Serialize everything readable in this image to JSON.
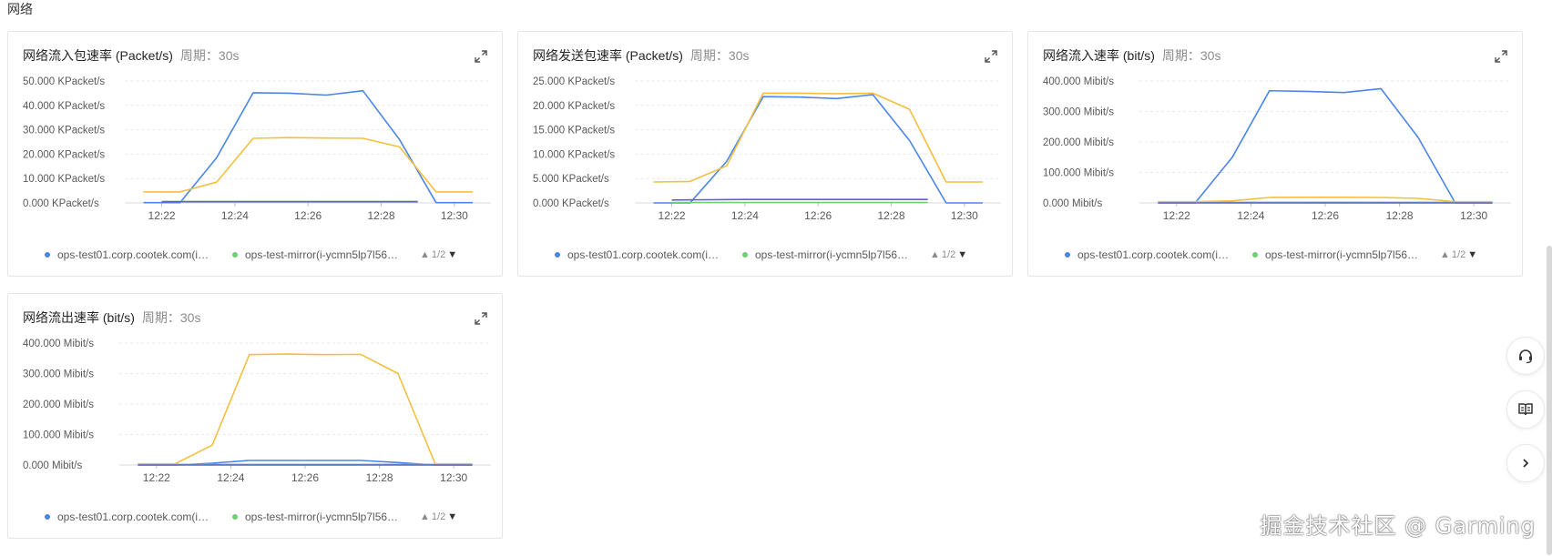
{
  "section_title": "网络",
  "period_label": "周期：",
  "period_value": "30s",
  "legend_pager": "1/2",
  "watermark": "掘金技术社区 @ Garming",
  "colors": {
    "series_1": "#4a86e8",
    "series_2": "#6fcf6f",
    "series_3": "#f3c03e",
    "series_4": "#5b5fd6"
  },
  "chart_data": [
    {
      "type": "line",
      "title": "网络流入包速率 (Packet/s)",
      "period": "30s",
      "x": [
        "12:21:30",
        "12:22",
        "12:22:30",
        "12:23",
        "12:23:30",
        "12:24",
        "12:24:30",
        "12:25",
        "12:25:30",
        "12:26",
        "12:26:30",
        "12:27",
        "12:27:30",
        "12:28",
        "12:28:30",
        "12:29",
        "12:29:30",
        "12:30",
        "12:30:30"
      ],
      "xticks": [
        "12:22",
        "12:24",
        "12:26",
        "12:28",
        "12:30"
      ],
      "yticks": [
        "0.000 KPacket/s",
        "10.000 KPacket/s",
        "20.000 KPacket/s",
        "30.000 KPacket/s",
        "40.000 KPacket/s",
        "50.000 KPacket/s"
      ],
      "ylim": [
        0,
        50
      ],
      "grid": true,
      "series": [
        {
          "name": "ops-test01.corp.cootek.com(i-y...",
          "color": "#4a86e8",
          "points": [
            [
              "12:21:30",
              0.1
            ],
            [
              "12:22:30",
              0.1
            ],
            [
              "12:23:30",
              18.5
            ],
            [
              "12:24:30",
              45.2
            ],
            [
              "12:25:30",
              45
            ],
            [
              "12:26:30",
              44.2
            ],
            [
              "12:27:30",
              46
            ],
            [
              "12:28:30",
              26
            ],
            [
              "12:29:30",
              0.1
            ],
            [
              "12:30:30",
              0.1
            ]
          ]
        },
        {
          "name": "ops-test-mirror(i-ycmn5lp7l561jh...",
          "color": "#6fcf6f",
          "points": [
            [
              "12:22",
              0.6
            ],
            [
              "12:29",
              0.6
            ]
          ]
        },
        {
          "name": "",
          "color": "#f3c03e",
          "points": [
            [
              "12:21:30",
              4.5
            ],
            [
              "12:22:30",
              4.5
            ],
            [
              "12:23:30",
              8.5
            ],
            [
              "12:24:30",
              26.5
            ],
            [
              "12:25:30",
              26.8
            ],
            [
              "12:26:30",
              26.6
            ],
            [
              "12:27:30",
              26.5
            ],
            [
              "12:28:30",
              23
            ],
            [
              "12:29:30",
              4.5
            ],
            [
              "12:30:30",
              4.5
            ]
          ]
        },
        {
          "name": "",
          "color": "#5b5fd6",
          "points": [
            [
              "12:22",
              0.5
            ],
            [
              "12:29",
              0.5
            ]
          ]
        }
      ],
      "legend": [
        "ops-test01.corp.cootek.com(i-y...",
        "ops-test-mirror(i-ycmn5lp7l561jh..."
      ]
    },
    {
      "type": "line",
      "title": "网络发送包速率 (Packet/s)",
      "period": "30s",
      "xticks": [
        "12:22",
        "12:24",
        "12:26",
        "12:28",
        "12:30"
      ],
      "yticks": [
        "0.000 KPacket/s",
        "5.000 KPacket/s",
        "10.000 KPacket/s",
        "15.000 KPacket/s",
        "20.000 KPacket/s",
        "25.000 KPacket/s"
      ],
      "ylim": [
        0,
        25
      ],
      "grid": true,
      "series": [
        {
          "name": "ops-test01.corp.cootek.com(i-y...",
          "color": "#4a86e8",
          "points": [
            [
              "12:21:30",
              0
            ],
            [
              "12:22:30",
              0
            ],
            [
              "12:23:30",
              8.5
            ],
            [
              "12:24:30",
              21.8
            ],
            [
              "12:25:30",
              21.7
            ],
            [
              "12:26:30",
              21.4
            ],
            [
              "12:27:30",
              22.2
            ],
            [
              "12:28:30",
              12.8
            ],
            [
              "12:29:30",
              0
            ],
            [
              "12:30:30",
              0
            ]
          ]
        },
        {
          "name": "ops-test-mirror(i-ycmn5lp7l561jh...",
          "color": "#6fcf6f",
          "points": [
            [
              "12:22",
              0.1
            ],
            [
              "12:29",
              0.1
            ]
          ]
        },
        {
          "name": "",
          "color": "#f3c03e",
          "points": [
            [
              "12:21:30",
              4.3
            ],
            [
              "12:22:30",
              4.4
            ],
            [
              "12:23:30",
              7.6
            ],
            [
              "12:24:30",
              22.5
            ],
            [
              "12:25:30",
              22.5
            ],
            [
              "12:26:30",
              22.4
            ],
            [
              "12:27:30",
              22.5
            ],
            [
              "12:28:30",
              19.2
            ],
            [
              "12:29:30",
              4.3
            ],
            [
              "12:30:30",
              4.3
            ]
          ]
        },
        {
          "name": "",
          "color": "#5b5fd6",
          "points": [
            [
              "12:22",
              0.6
            ],
            [
              "12:24",
              0.7
            ],
            [
              "12:26",
              0.7
            ],
            [
              "12:29",
              0.7
            ]
          ]
        }
      ],
      "legend": [
        "ops-test01.corp.cootek.com(i-y...",
        "ops-test-mirror(i-ycmn5lp7l561jh..."
      ]
    },
    {
      "type": "line",
      "title": "网络流入速率 (bit/s)",
      "period": "30s",
      "xticks": [
        "12:22",
        "12:24",
        "12:26",
        "12:28",
        "12:30"
      ],
      "yticks": [
        "0.000 Mibit/s",
        "100.000 Mibit/s",
        "200.000 Mibit/s",
        "300.000 Mibit/s",
        "400.000 Mibit/s"
      ],
      "ylim": [
        0,
        400
      ],
      "grid": true,
      "series": [
        {
          "name": "ops-test01.corp.cootek.com(i-y...",
          "color": "#4a86e8",
          "points": [
            [
              "12:21:30",
              0
            ],
            [
              "12:22:30",
              0
            ],
            [
              "12:23:30",
              150
            ],
            [
              "12:24:30",
              368
            ],
            [
              "12:25:30",
              366
            ],
            [
              "12:26:30",
              362
            ],
            [
              "12:27:30",
              375
            ],
            [
              "12:28:30",
              215
            ],
            [
              "12:29:30",
              0
            ],
            [
              "12:30:30",
              0
            ]
          ]
        },
        {
          "name": "ops-test-mirror(i-ycmn5lp7l561jh...",
          "color": "#6fcf6f",
          "points": [
            [
              "12:21:30",
              2
            ],
            [
              "12:30:30",
              2
            ]
          ]
        },
        {
          "name": "",
          "color": "#f3c03e",
          "points": [
            [
              "12:21:30",
              4
            ],
            [
              "12:22:30",
              4
            ],
            [
              "12:23:30",
              7
            ],
            [
              "12:24:30",
              18
            ],
            [
              "12:25:30",
              18.5
            ],
            [
              "12:26:30",
              18.5
            ],
            [
              "12:27:30",
              18
            ],
            [
              "12:28:30",
              15
            ],
            [
              "12:29:30",
              4
            ],
            [
              "12:30:30",
              4
            ]
          ]
        },
        {
          "name": "",
          "color": "#5b5fd6",
          "points": [
            [
              "12:21:30",
              0
            ],
            [
              "12:30:30",
              0
            ]
          ]
        }
      ],
      "legend": [
        "ops-test01.corp.cootek.com(i-y...",
        "ops-test-mirror(i-ycmn5lp7l561jh..."
      ]
    },
    {
      "type": "line",
      "title": "网络流出速率 (bit/s)",
      "period": "30s",
      "xticks": [
        "12:22",
        "12:24",
        "12:26",
        "12:28",
        "12:30"
      ],
      "yticks": [
        "0.000 Mibit/s",
        "100.000 Mibit/s",
        "200.000 Mibit/s",
        "300.000 Mibit/s",
        "400.000 Mibit/s"
      ],
      "ylim": [
        0,
        400
      ],
      "grid": true,
      "series": [
        {
          "name": "ops-test01.corp.cootek.com(i-y...",
          "color": "#4a86e8",
          "points": [
            [
              "12:21:30",
              0
            ],
            [
              "12:22:30",
              0
            ],
            [
              "12:23:30",
              6
            ],
            [
              "12:24:30",
              15
            ],
            [
              "12:25:30",
              15
            ],
            [
              "12:26:30",
              15
            ],
            [
              "12:27:30",
              15
            ],
            [
              "12:28:30",
              8
            ],
            [
              "12:29:30",
              0
            ],
            [
              "12:30:30",
              0
            ]
          ]
        },
        {
          "name": "ops-test-mirror(i-ycmn5lp7l561jh...",
          "color": "#6fcf6f",
          "points": [
            [
              "12:21:30",
              2
            ],
            [
              "12:30:30",
              2
            ]
          ]
        },
        {
          "name": "",
          "color": "#f3c03e",
          "points": [
            [
              "12:21:30",
              4
            ],
            [
              "12:22:30",
              4
            ],
            [
              "12:23:30",
              65
            ],
            [
              "12:24:30",
              362
            ],
            [
              "12:25:30",
              364
            ],
            [
              "12:26:30",
              362
            ],
            [
              "12:27:30",
              363
            ],
            [
              "12:28:30",
              300
            ],
            [
              "12:29:30",
              4
            ],
            [
              "12:30:30",
              4
            ]
          ]
        },
        {
          "name": "",
          "color": "#5b5fd6",
          "points": [
            [
              "12:21:30",
              0
            ],
            [
              "12:30:30",
              0
            ]
          ]
        }
      ],
      "legend": [
        "ops-test01.corp.cootek.com(i-y...",
        "ops-test-mirror(i-ycmn5lp7l561jh..."
      ]
    }
  ]
}
